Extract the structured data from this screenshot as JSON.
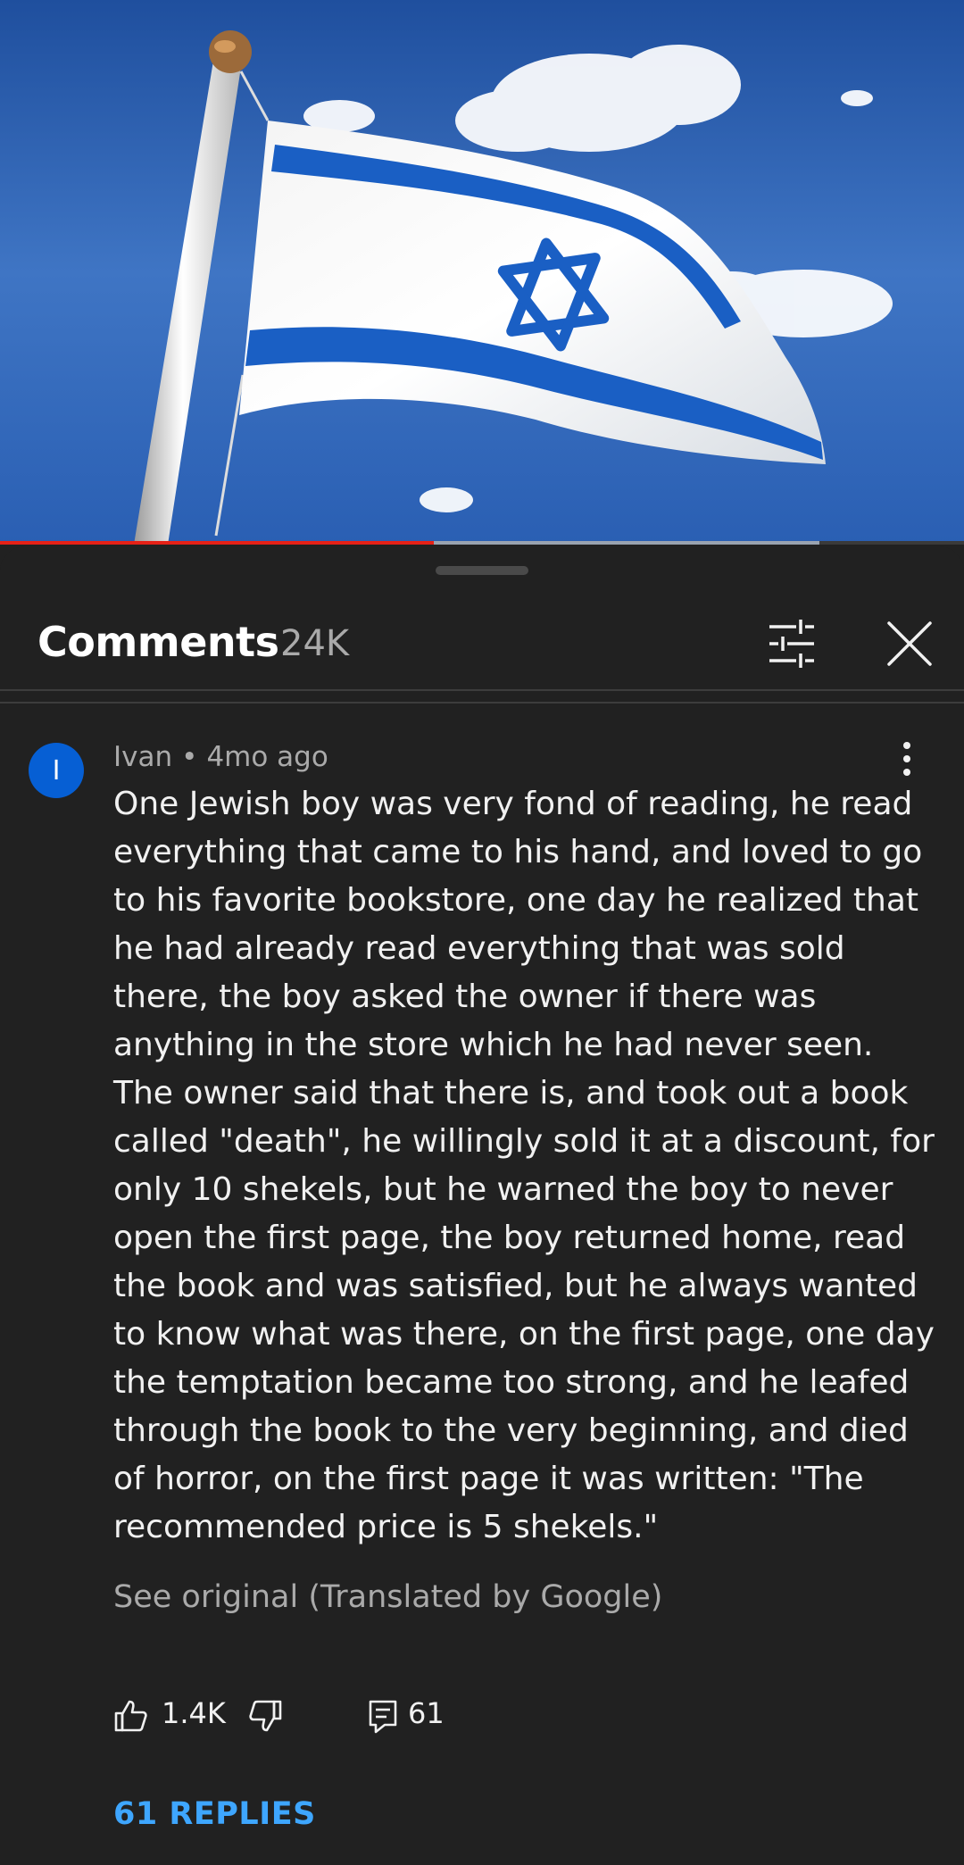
{
  "video": {
    "thumbnail_subject": "flag-of-israel-waving",
    "progress_played_fraction": 0.45,
    "progress_buffered_fraction": 0.85
  },
  "comments_panel": {
    "title": "Comments",
    "count": "24K",
    "icons": {
      "filter": "sort-filter-icon",
      "close": "close-icon"
    }
  },
  "comment": {
    "avatar_letter": "I",
    "avatar_color": "#065fd4",
    "author": "Ivan",
    "separator": "•",
    "time": "4mo ago",
    "text": "One Jewish boy was very fond of reading, he read everything that came to his hand, and loved to go to his favorite bookstore, one day he realized that he had already read everything that was sold there, the boy asked the owner if there was anything in the store which he had never seen.\nThe owner said that there is, and took out a book called \"death\", he willingly sold it at a discount, for only 10 shekels, but he warned the boy to never open the first page, the boy returned home, read the book and was satisfied, but he always wanted to know what was there, on the first page, one day the temptation became too strong, and he leafed through the book to the very beginning, and died of horror, on the first page it was written: \"The recommended price is 5 shekels.\"",
    "translation_note": "See original (Translated by Google)",
    "likes": "1.4K",
    "reply_count": "61",
    "replies_link": "61 REPLIES",
    "accent_color": "#3ea6ff"
  }
}
